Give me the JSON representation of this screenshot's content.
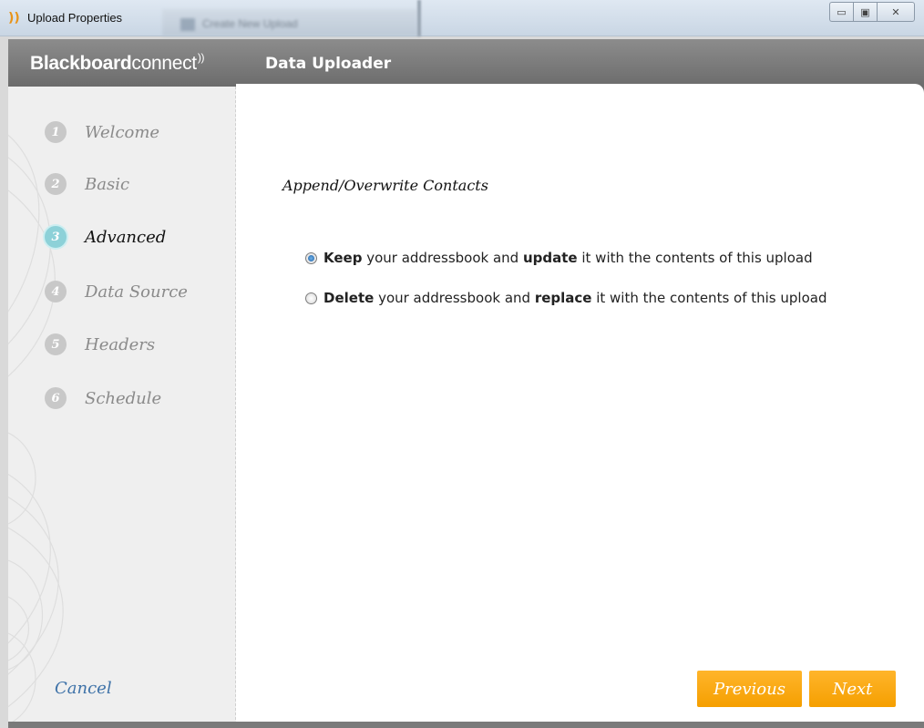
{
  "window": {
    "title": "Upload Properties",
    "background_tab_label": "Create New Upload",
    "controls": [
      "minimize",
      "restore",
      "close"
    ]
  },
  "header": {
    "logo_bold": "Blackboard",
    "logo_light": "connect",
    "logo_mark": "))",
    "subtitle": "Data Uploader"
  },
  "steps": [
    {
      "number": "1",
      "label": "Welcome",
      "active": false
    },
    {
      "number": "2",
      "label": "Basic",
      "active": false
    },
    {
      "number": "3",
      "label": "Advanced",
      "active": true
    },
    {
      "number": "4",
      "label": "Data Source",
      "active": false
    },
    {
      "number": "5",
      "label": "Headers",
      "active": false
    },
    {
      "number": "6",
      "label": "Schedule",
      "active": false
    }
  ],
  "main": {
    "section_title": "Append/Overwrite Contacts",
    "options": [
      {
        "checked": true,
        "bold1": "Keep",
        "text1": " your addressbook and ",
        "bold2": "update",
        "text2": " it with the contents of this upload"
      },
      {
        "checked": false,
        "bold1": "Delete",
        "text1": " your addressbook and ",
        "bold2": "replace",
        "text2": " it with the contents of this upload"
      }
    ]
  },
  "footer": {
    "cancel_label": "Cancel",
    "previous_label": "Previous",
    "next_label": "Next"
  },
  "colors": {
    "accent_orange": "#f7a600",
    "active_step": "#8dd1d8",
    "link_blue": "#3e72a8",
    "header_gray": "#7a7a7a"
  }
}
